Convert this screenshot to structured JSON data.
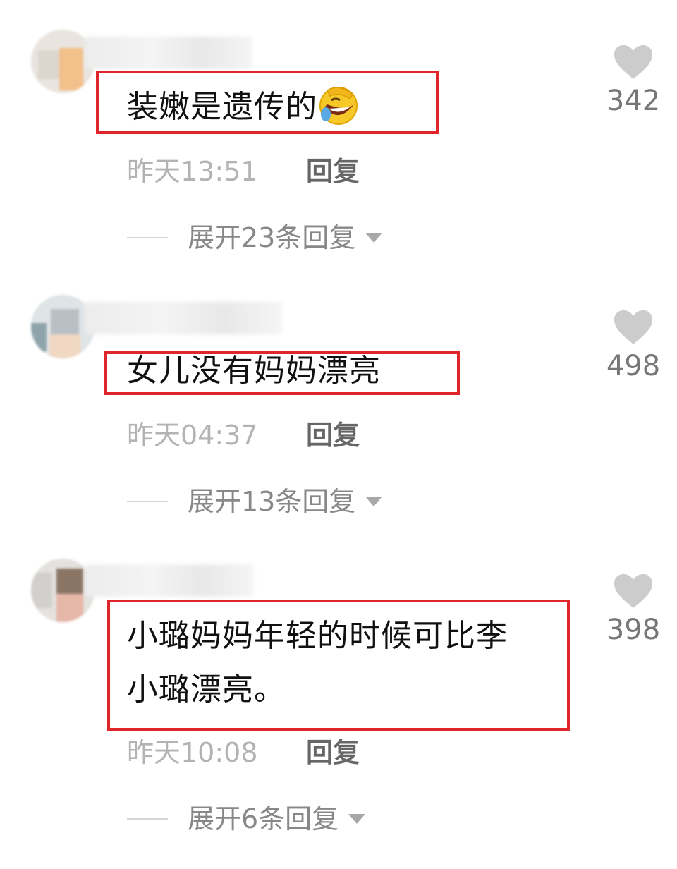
{
  "comments": [
    {
      "text": "装嫩是遗传的",
      "emoji": "laughing-crying-face-emoji",
      "time": "昨天13:51",
      "reply_label": "回复",
      "expand_label": "展开23条回复",
      "likes": "342"
    },
    {
      "text": "女儿没有妈妈漂亮",
      "time": "昨天04:37",
      "reply_label": "回复",
      "expand_label": "展开13条回复",
      "likes": "498"
    },
    {
      "text_line1": "小璐妈妈年轻的时候可比李",
      "text_line2": "小璐漂亮。",
      "time": "昨天10:08",
      "reply_label": "回复",
      "expand_label": "展开6条回复",
      "likes": "398"
    }
  ],
  "colors": {
    "highlight": "#e0262b",
    "time": "#b3b3b3",
    "reply": "#666666",
    "expand": "#888888",
    "heart": "#cccccc",
    "like_count": "#777777"
  },
  "icons": {
    "like": "heart-icon",
    "expand": "triangle-down-icon"
  }
}
